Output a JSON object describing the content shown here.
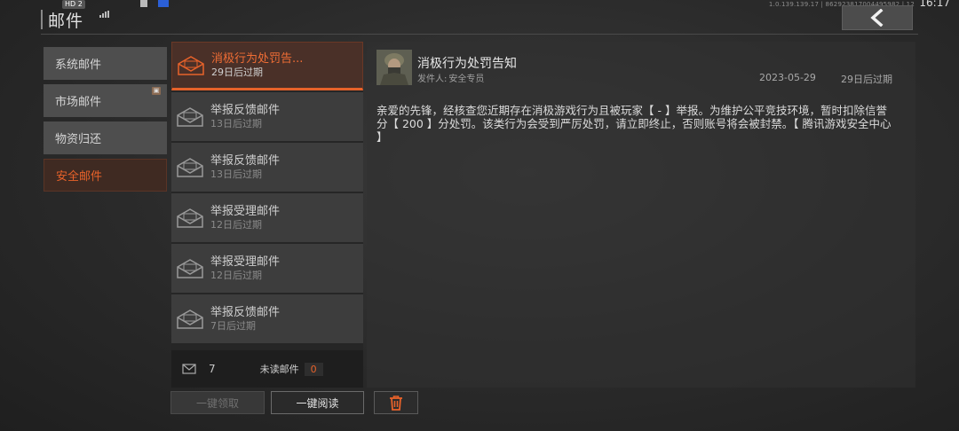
{
  "status_bar": {
    "hd_label": "HD 2",
    "version": "1.0.139.139.17 | 862923817004495982 | 12",
    "clock": "16:17"
  },
  "header": {
    "title": "邮件"
  },
  "sidebar": {
    "items": [
      {
        "label": "系统邮件",
        "active": false
      },
      {
        "label": "市场邮件",
        "active": false
      },
      {
        "label": "物资归还",
        "active": false
      },
      {
        "label": "安全邮件",
        "active": true
      }
    ]
  },
  "mail_list": {
    "items": [
      {
        "subject": "消极行为处罚告...",
        "expiry": "29日后过期",
        "active": true
      },
      {
        "subject": "举报反馈邮件",
        "expiry": "13日后过期",
        "active": false
      },
      {
        "subject": "举报反馈邮件",
        "expiry": "13日后过期",
        "active": false
      },
      {
        "subject": "举报受理邮件",
        "expiry": "12日后过期",
        "active": false
      },
      {
        "subject": "举报受理邮件",
        "expiry": "12日后过期",
        "active": false
      },
      {
        "subject": "举报反馈邮件",
        "expiry": "7日后过期",
        "active": false
      }
    ],
    "footer": {
      "total": "7",
      "unread_label": "未读邮件",
      "unread_count": "0"
    }
  },
  "detail": {
    "title": "消极行为处罚告知",
    "sender_label": "发件人:",
    "sender": "安全专员",
    "date": "2023-05-29",
    "expiry": "29日后过期",
    "body": "亲爱的先锋，经核查您近期存在消极游戏行为且被玩家【 - 】举报。为维护公平竞技环境，暂时扣除信誉分【 200 】分处罚。该类行为会受到严厉处罚，请立即终止，否则账号将会被封禁。【 腾讯游戏安全中心 】"
  },
  "actions": {
    "claim_all": "一键领取",
    "read_all": "一键阅读"
  },
  "colors": {
    "accent": "#e8622a"
  }
}
